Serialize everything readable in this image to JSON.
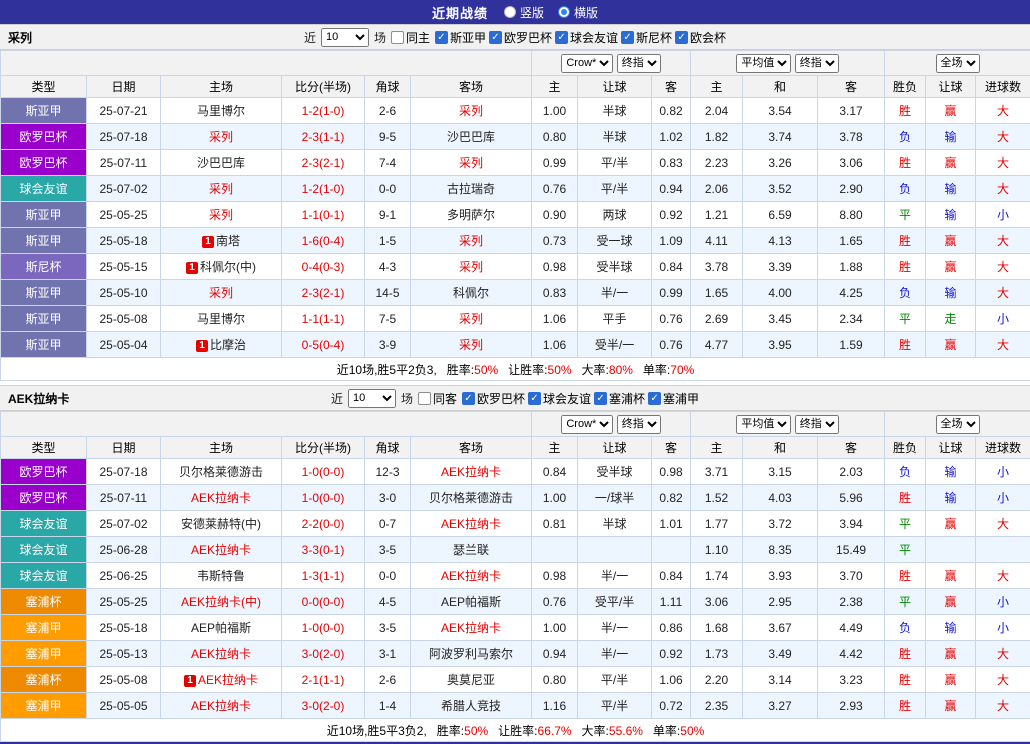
{
  "title_bar": {
    "title": "近期战绩",
    "view_options": [
      {
        "label": "竖版",
        "selected": false
      },
      {
        "label": "横版",
        "selected": true
      }
    ]
  },
  "palette": {
    "title_bar_bg": "#31319C",
    "red": "#E60000",
    "blue": "#1414D2",
    "green": "#008800",
    "row_alt_bg": "#EDF5FF",
    "grid_line": "#C9D6E8",
    "league_siyajia": "#7173AE",
    "league_ouluoba": "#9900CC",
    "league_qiuhuiyouyi": "#2AA7A7",
    "league_sinibei": "#7B68BE",
    "league_saipubei": "#EE8A00",
    "league_saipujia": "#FF9D00"
  },
  "sections": [
    {
      "team": "采列",
      "filters": {
        "near_label": "近",
        "count": "10",
        "count_suffix": "场",
        "same_label": "同主",
        "same_checked": false,
        "leagues": [
          {
            "label": "斯亚甲",
            "checked": true
          },
          {
            "label": "欧罗巴杯",
            "checked": true
          },
          {
            "label": "球会友谊",
            "checked": true
          },
          {
            "label": "斯尼杯",
            "checked": true
          },
          {
            "label": "欧会杯",
            "checked": true
          }
        ]
      },
      "dropdowns": {
        "odds_company": "Crow*",
        "odds_stage": "终指",
        "avg_label": "平均值",
        "avg_stage": "终指",
        "scope": "全场"
      },
      "columns": [
        "类型",
        "日期",
        "主场",
        "比分(半场)",
        "角球",
        "客场",
        "主",
        "让球",
        "客",
        "主",
        "和",
        "客",
        "胜负",
        "让球",
        "进球数"
      ],
      "rows": [
        {
          "league": "斯亚甲",
          "league_color": "#7173AE",
          "date": "25-07-21",
          "home": "马里博尔",
          "home_red": false,
          "home_badge": "",
          "score": "1-2(1-0)",
          "corner": "2-6",
          "away": "采列",
          "away_red": true,
          "away_badge": "",
          "oh": "1.00",
          "line": "半球",
          "oa": "0.82",
          "avg_h": "2.04",
          "avg_d": "3.54",
          "avg_a": "3.17",
          "result": "胜",
          "result_c": "red",
          "hresult": "赢",
          "hresult_c": "red",
          "goals": "大",
          "goals_c": "red"
        },
        {
          "league": "欧罗巴杯",
          "league_color": "#9900CC",
          "date": "25-07-18",
          "home": "采列",
          "home_red": true,
          "home_badge": "",
          "score": "2-3(1-1)",
          "corner": "9-5",
          "away": "沙巴巴库",
          "away_red": false,
          "away_badge": "",
          "oh": "0.80",
          "line": "半球",
          "oa": "1.02",
          "avg_h": "1.82",
          "avg_d": "3.74",
          "avg_a": "3.78",
          "result": "负",
          "result_c": "blue",
          "hresult": "输",
          "hresult_c": "blue",
          "goals": "大",
          "goals_c": "red"
        },
        {
          "league": "欧罗巴杯",
          "league_color": "#9900CC",
          "date": "25-07-11",
          "home": "沙巴巴库",
          "home_red": false,
          "home_badge": "",
          "score": "2-3(2-1)",
          "corner": "7-4",
          "away": "采列",
          "away_red": true,
          "away_badge": "",
          "oh": "0.99",
          "line": "平/半",
          "oa": "0.83",
          "avg_h": "2.23",
          "avg_d": "3.26",
          "avg_a": "3.06",
          "result": "胜",
          "result_c": "red",
          "hresult": "赢",
          "hresult_c": "red",
          "goals": "大",
          "goals_c": "red"
        },
        {
          "league": "球会友谊",
          "league_color": "#2AA7A7",
          "date": "25-07-02",
          "home": "采列",
          "home_red": true,
          "home_badge": "",
          "score": "1-2(1-0)",
          "corner": "0-0",
          "away": "古拉瑞奇",
          "away_red": false,
          "away_badge": "",
          "oh": "0.76",
          "line": "平/半",
          "oa": "0.94",
          "avg_h": "2.06",
          "avg_d": "3.52",
          "avg_a": "2.90",
          "result": "负",
          "result_c": "blue",
          "hresult": "输",
          "hresult_c": "blue",
          "goals": "大",
          "goals_c": "red"
        },
        {
          "league": "斯亚甲",
          "league_color": "#7173AE",
          "date": "25-05-25",
          "home": "采列",
          "home_red": true,
          "home_badge": "",
          "score": "1-1(0-1)",
          "corner": "9-1",
          "away": "多明萨尔",
          "away_red": false,
          "away_badge": "",
          "oh": "0.90",
          "line": "两球",
          "oa": "0.92",
          "avg_h": "1.21",
          "avg_d": "6.59",
          "avg_a": "8.80",
          "result": "平",
          "result_c": "green",
          "hresult": "输",
          "hresult_c": "blue",
          "goals": "小",
          "goals_c": "blue"
        },
        {
          "league": "斯亚甲",
          "league_color": "#7173AE",
          "date": "25-05-18",
          "home": "南塔",
          "home_red": false,
          "home_badge": "1",
          "score": "1-6(0-4)",
          "corner": "1-5",
          "away": "采列",
          "away_red": true,
          "away_badge": "",
          "oh": "0.73",
          "line": "受一球",
          "oa": "1.09",
          "avg_h": "4.11",
          "avg_d": "4.13",
          "avg_a": "1.65",
          "result": "胜",
          "result_c": "red",
          "hresult": "赢",
          "hresult_c": "red",
          "goals": "大",
          "goals_c": "red"
        },
        {
          "league": "斯尼杯",
          "league_color": "#7B68BE",
          "date": "25-05-15",
          "home": "科佩尔(中)",
          "home_red": false,
          "home_badge": "1",
          "score": "0-4(0-3)",
          "corner": "4-3",
          "away": "采列",
          "away_red": true,
          "away_badge": "",
          "oh": "0.98",
          "line": "受半球",
          "oa": "0.84",
          "avg_h": "3.78",
          "avg_d": "3.39",
          "avg_a": "1.88",
          "result": "胜",
          "result_c": "red",
          "hresult": "赢",
          "hresult_c": "red",
          "goals": "大",
          "goals_c": "red"
        },
        {
          "league": "斯亚甲",
          "league_color": "#7173AE",
          "date": "25-05-10",
          "home": "采列",
          "home_red": true,
          "home_badge": "",
          "score": "2-3(2-1)",
          "corner": "14-5",
          "away": "科佩尔",
          "away_red": false,
          "away_badge": "",
          "oh": "0.83",
          "line": "半/一",
          "oa": "0.99",
          "avg_h": "1.65",
          "avg_d": "4.00",
          "avg_a": "4.25",
          "result": "负",
          "result_c": "blue",
          "hresult": "输",
          "hresult_c": "blue",
          "goals": "大",
          "goals_c": "red"
        },
        {
          "league": "斯亚甲",
          "league_color": "#7173AE",
          "date": "25-05-08",
          "home": "马里博尔",
          "home_red": false,
          "home_badge": "",
          "score": "1-1(1-1)",
          "corner": "7-5",
          "away": "采列",
          "away_red": true,
          "away_badge": "",
          "oh": "1.06",
          "line": "平手",
          "oa": "0.76",
          "avg_h": "2.69",
          "avg_d": "3.45",
          "avg_a": "2.34",
          "result": "平",
          "result_c": "green",
          "hresult": "走",
          "hresult_c": "green",
          "goals": "小",
          "goals_c": "blue"
        },
        {
          "league": "斯亚甲",
          "league_color": "#7173AE",
          "date": "25-05-04",
          "home": "比摩治",
          "home_red": false,
          "home_badge": "1",
          "score": "0-5(0-4)",
          "corner": "3-9",
          "away": "采列",
          "away_red": true,
          "away_badge": "",
          "oh": "1.06",
          "line": "受半/一",
          "oa": "0.76",
          "avg_h": "4.77",
          "avg_d": "3.95",
          "avg_a": "1.59",
          "result": "胜",
          "result_c": "red",
          "hresult": "赢",
          "hresult_c": "red",
          "goals": "大",
          "goals_c": "red"
        }
      ],
      "summary": {
        "prefix": "近10场,胜5平2负3,",
        "stats": [
          {
            "label": "胜率:",
            "value": "50%"
          },
          {
            "label": "让胜率:",
            "value": "50%"
          },
          {
            "label": "大率:",
            "value": "80%"
          },
          {
            "label": "单率:",
            "value": "70%"
          }
        ]
      }
    },
    {
      "team": "AEK拉纳卡",
      "filters": {
        "near_label": "近",
        "count": "10",
        "count_suffix": "场",
        "same_label": "同客",
        "same_checked": false,
        "leagues": [
          {
            "label": "欧罗巴杯",
            "checked": true
          },
          {
            "label": "球会友谊",
            "checked": true
          },
          {
            "label": "塞浦杯",
            "checked": true
          },
          {
            "label": "塞浦甲",
            "checked": true
          }
        ]
      },
      "dropdowns": {
        "odds_company": "Crow*",
        "odds_stage": "终指",
        "avg_label": "平均值",
        "avg_stage": "终指",
        "scope": "全场"
      },
      "columns": [
        "类型",
        "日期",
        "主场",
        "比分(半场)",
        "角球",
        "客场",
        "主",
        "让球",
        "客",
        "主",
        "和",
        "客",
        "胜负",
        "让球",
        "进球数"
      ],
      "rows": [
        {
          "league": "欧罗巴杯",
          "league_color": "#9900CC",
          "date": "25-07-18",
          "home": "贝尔格莱德游击",
          "home_red": false,
          "home_badge": "",
          "score": "1-0(0-0)",
          "corner": "12-3",
          "away": "AEK拉纳卡",
          "away_red": true,
          "away_badge": "",
          "oh": "0.84",
          "line": "受半球",
          "oa": "0.98",
          "avg_h": "3.71",
          "avg_d": "3.15",
          "avg_a": "2.03",
          "result": "负",
          "result_c": "blue",
          "hresult": "输",
          "hresult_c": "blue",
          "goals": "小",
          "goals_c": "blue"
        },
        {
          "league": "欧罗巴杯",
          "league_color": "#9900CC",
          "date": "25-07-11",
          "home": "AEK拉纳卡",
          "home_red": true,
          "home_badge": "",
          "score": "1-0(0-0)",
          "corner": "3-0",
          "away": "贝尔格莱德游击",
          "away_red": false,
          "away_badge": "",
          "oh": "1.00",
          "line": "一/球半",
          "oa": "0.82",
          "avg_h": "1.52",
          "avg_d": "4.03",
          "avg_a": "5.96",
          "result": "胜",
          "result_c": "red",
          "hresult": "输",
          "hresult_c": "blue",
          "goals": "小",
          "goals_c": "blue"
        },
        {
          "league": "球会友谊",
          "league_color": "#2AA7A7",
          "date": "25-07-02",
          "home": "安德莱赫特(中)",
          "home_red": false,
          "home_badge": "",
          "score": "2-2(0-0)",
          "corner": "0-7",
          "away": "AEK拉纳卡",
          "away_red": true,
          "away_badge": "",
          "oh": "0.81",
          "line": "半球",
          "oa": "1.01",
          "avg_h": "1.77",
          "avg_d": "3.72",
          "avg_a": "3.94",
          "result": "平",
          "result_c": "green",
          "hresult": "赢",
          "hresult_c": "red",
          "goals": "大",
          "goals_c": "red"
        },
        {
          "league": "球会友谊",
          "league_color": "#2AA7A7",
          "date": "25-06-28",
          "home": "AEK拉纳卡",
          "home_red": true,
          "home_badge": "",
          "score": "3-3(0-1)",
          "corner": "3-5",
          "away": "瑟兰联",
          "away_red": false,
          "away_badge": "",
          "oh": "",
          "line": "",
          "oa": "",
          "avg_h": "1.10",
          "avg_d": "8.35",
          "avg_a": "15.49",
          "result": "平",
          "result_c": "green",
          "hresult": "",
          "hresult_c": "",
          "goals": "",
          "goals_c": ""
        },
        {
          "league": "球会友谊",
          "league_color": "#2AA7A7",
          "date": "25-06-25",
          "home": "韦斯特鲁",
          "home_red": false,
          "home_badge": "",
          "score": "1-3(1-1)",
          "corner": "0-0",
          "away": "AEK拉纳卡",
          "away_red": true,
          "away_badge": "",
          "oh": "0.98",
          "line": "半/一",
          "oa": "0.84",
          "avg_h": "1.74",
          "avg_d": "3.93",
          "avg_a": "3.70",
          "result": "胜",
          "result_c": "red",
          "hresult": "赢",
          "hresult_c": "red",
          "goals": "大",
          "goals_c": "red"
        },
        {
          "league": "塞浦杯",
          "league_color": "#EE8A00",
          "date": "25-05-25",
          "home": "AEK拉纳卡(中)",
          "home_red": true,
          "home_badge": "",
          "score": "0-0(0-0)",
          "corner": "4-5",
          "away": "AEP帕福斯",
          "away_red": false,
          "away_badge": "",
          "oh": "0.76",
          "line": "受平/半",
          "oa": "1.11",
          "avg_h": "3.06",
          "avg_d": "2.95",
          "avg_a": "2.38",
          "result": "平",
          "result_c": "green",
          "hresult": "赢",
          "hresult_c": "red",
          "goals": "小",
          "goals_c": "blue"
        },
        {
          "league": "塞浦甲",
          "league_color": "#FF9D00",
          "date": "25-05-18",
          "home": "AEP帕福斯",
          "home_red": false,
          "home_badge": "",
          "score": "1-0(0-0)",
          "corner": "3-5",
          "away": "AEK拉纳卡",
          "away_red": true,
          "away_badge": "",
          "oh": "1.00",
          "line": "半/一",
          "oa": "0.86",
          "avg_h": "1.68",
          "avg_d": "3.67",
          "avg_a": "4.49",
          "result": "负",
          "result_c": "blue",
          "hresult": "输",
          "hresult_c": "blue",
          "goals": "小",
          "goals_c": "blue"
        },
        {
          "league": "塞浦甲",
          "league_color": "#FF9D00",
          "date": "25-05-13",
          "home": "AEK拉纳卡",
          "home_red": true,
          "home_badge": "",
          "score": "3-0(2-0)",
          "corner": "3-1",
          "away": "阿波罗利马索尔",
          "away_red": false,
          "away_badge": "",
          "oh": "0.94",
          "line": "半/一",
          "oa": "0.92",
          "avg_h": "1.73",
          "avg_d": "3.49",
          "avg_a": "4.42",
          "result": "胜",
          "result_c": "red",
          "hresult": "赢",
          "hresult_c": "red",
          "goals": "大",
          "goals_c": "red"
        },
        {
          "league": "塞浦杯",
          "league_color": "#EE8A00",
          "date": "25-05-08",
          "home": "AEK拉纳卡",
          "home_red": true,
          "home_badge": "1",
          "score": "2-1(1-1)",
          "corner": "2-6",
          "away": "奥莫尼亚",
          "away_red": false,
          "away_badge": "",
          "oh": "0.80",
          "line": "平/半",
          "oa": "1.06",
          "avg_h": "2.20",
          "avg_d": "3.14",
          "avg_a": "3.23",
          "result": "胜",
          "result_c": "red",
          "hresult": "赢",
          "hresult_c": "red",
          "goals": "大",
          "goals_c": "red"
        },
        {
          "league": "塞浦甲",
          "league_color": "#FF9D00",
          "date": "25-05-05",
          "home": "AEK拉纳卡",
          "home_red": true,
          "home_badge": "",
          "score": "3-0(2-0)",
          "corner": "1-4",
          "away": "希腊人竞技",
          "away_red": false,
          "away_badge": "",
          "oh": "1.16",
          "line": "平/半",
          "oa": "0.72",
          "avg_h": "2.35",
          "avg_d": "3.27",
          "avg_a": "2.93",
          "result": "胜",
          "result_c": "red",
          "hresult": "赢",
          "hresult_c": "red",
          "goals": "大",
          "goals_c": "red"
        }
      ],
      "summary": {
        "prefix": "近10场,胜5平3负2,",
        "stats": [
          {
            "label": "胜率:",
            "value": "50%"
          },
          {
            "label": "让胜率:",
            "value": "66.7%"
          },
          {
            "label": "大率:",
            "value": "55.6%"
          },
          {
            "label": "单率:",
            "value": "50%"
          }
        ]
      }
    }
  ]
}
